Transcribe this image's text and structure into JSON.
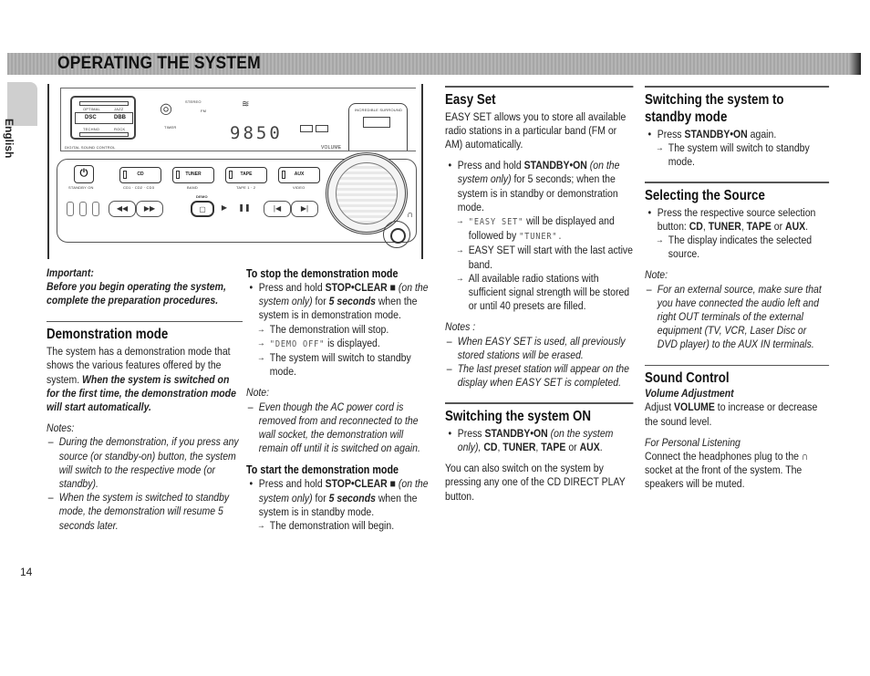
{
  "header": {
    "title": "OPERATING THE SYSTEM",
    "language_tab": "English"
  },
  "device": {
    "dsc": {
      "label": "DIGITAL SOUND CONTROL",
      "top_left": "OPTIMAL",
      "top_right": "JAZZ",
      "bottom_left": "TECHNO",
      "bottom_right": "ROCK",
      "dsc_button": "DSC",
      "dbb_button": "DBB"
    },
    "display": {
      "stereo": "STEREO",
      "band": "FM",
      "timer": "TIMER",
      "frequency": "9850",
      "volume_label": "VOLUME",
      "surround_label": "INCREDIBLE SURROUND"
    },
    "source_buttons": [
      {
        "label": "CD",
        "sub": "CD1 · CD2 · CD3"
      },
      {
        "label": "TUNER",
        "sub": "BAND"
      },
      {
        "label": "TAPE",
        "sub": "TAPE 1 · 2"
      },
      {
        "label": "AUX",
        "sub": "VIDEO"
      }
    ],
    "standby_label": "STANDBY ON",
    "demo_label": "DEMO",
    "transport": {
      "rewind": "◀◀",
      "forward": "▶▶",
      "stop": "▢",
      "play": "▶",
      "pause": "❚❚",
      "prev": "|◀",
      "next": "▶|"
    }
  },
  "col1": {
    "important_label": "Important:",
    "important_text": "Before you begin operating the system, complete the preparation procedures.",
    "demo_heading": "Demonstration mode",
    "demo_intro": "The system has a demonstration mode that shows the various features offered by the system.",
    "demo_intro_bold": "When the system is switched on for the first time, the demonstration mode will start automatically.",
    "notes_label": "Notes:",
    "notes": [
      "During the demonstration, if you press any source (or standby-on) button, the system will switch to the respective mode (or standby).",
      "When the system is switched to standby mode, the demonstration will resume 5 seconds later."
    ]
  },
  "col2": {
    "stop_heading": "To stop the demonstration mode",
    "stop_bullet": {
      "pre": "Press and hold",
      "key": "STOP•CLEAR ■",
      "italic": "(on the system only)",
      "mid": "for",
      "bold_italic": "5 seconds",
      "post": "when the system is in demonstration mode."
    },
    "stop_results": [
      "The demonstration will stop.",
      "is displayed.",
      "The system will switch to standby mode."
    ],
    "stop_lcd": "\"DEMO OFF\"",
    "note_label": "Note:",
    "note": "Even though the AC power cord is removed from and reconnected to the wall socket, the demonstration will remain off until it is switched on again.",
    "start_heading": "To start the demonstration mode",
    "start_bullet": {
      "pre": "Press and hold",
      "key": "STOP•CLEAR ■",
      "italic": "(on the system only)",
      "mid": "for",
      "bold_italic": "5 seconds",
      "post": "when the system is in standby mode."
    },
    "start_result": "The demonstration will begin."
  },
  "col3": {
    "easy_heading": "Easy Set",
    "easy_intro": "EASY SET allows you to store all available radio stations in a particular band (FM or AM) automatically.",
    "easy_bullet": {
      "pre": "Press and hold",
      "key": "STANDBY•ON",
      "italic": "(on the system only)",
      "post": "for 5 seconds; when the system is in standby or demonstration mode."
    },
    "easy_lcd1": "\"EASY SET\"",
    "easy_lcd_mid": "will be displayed and followed by",
    "easy_lcd2": "\"TUNER\".",
    "easy_results": [
      "EASY SET will start with the last active band.",
      "All available radio stations with sufficient signal strength will be stored or until 40 presets are filled."
    ],
    "notes_label": "Notes :",
    "notes": [
      "When EASY SET is used, all previously stored stations will be erased.",
      "The last preset station will appear on the display when EASY SET is completed."
    ],
    "on_heading": "Switching the system ON",
    "on_bullet": {
      "pre": "Press",
      "key": "STANDBY•ON",
      "italic": "(on the system only),",
      "keys": [
        "CD",
        "TUNER",
        "TAPE",
        "AUX"
      ],
      "or": "or"
    },
    "on_text": "You can also switch on the system by pressing any one of the CD DIRECT PLAY button."
  },
  "col4": {
    "standby_heading": "Switching the system to standby mode",
    "standby_bullet": {
      "pre": "Press",
      "key": "STANDBY•ON",
      "post": "again."
    },
    "standby_result": "The system will switch to standby mode.",
    "source_heading": "Selecting the Source",
    "source_bullet": {
      "pre": "Press the respective source selection button:",
      "keys": [
        "CD",
        "TUNER",
        "TAPE",
        "AUX"
      ],
      "or": "or"
    },
    "source_result": "The display indicates the selected source.",
    "note_label": "Note:",
    "note": "For an external source, make sure that you have connected the audio left and right OUT terminals of the external equipment (TV, VCR, Laser Disc or DVD player) to the AUX IN terminals.",
    "sound_heading": "Sound Control",
    "volume_sub": "Volume Adjustment",
    "volume_text": {
      "pre": "Adjust",
      "key": "VOLUME",
      "post": "to increase or decrease the sound level."
    },
    "personal_sub": "For Personal Listening",
    "personal_text_pre": "Connect the headphones plug to the",
    "personal_text_post": "socket at the front of the system. The speakers will be muted."
  },
  "footer": {
    "page_number": "14"
  }
}
